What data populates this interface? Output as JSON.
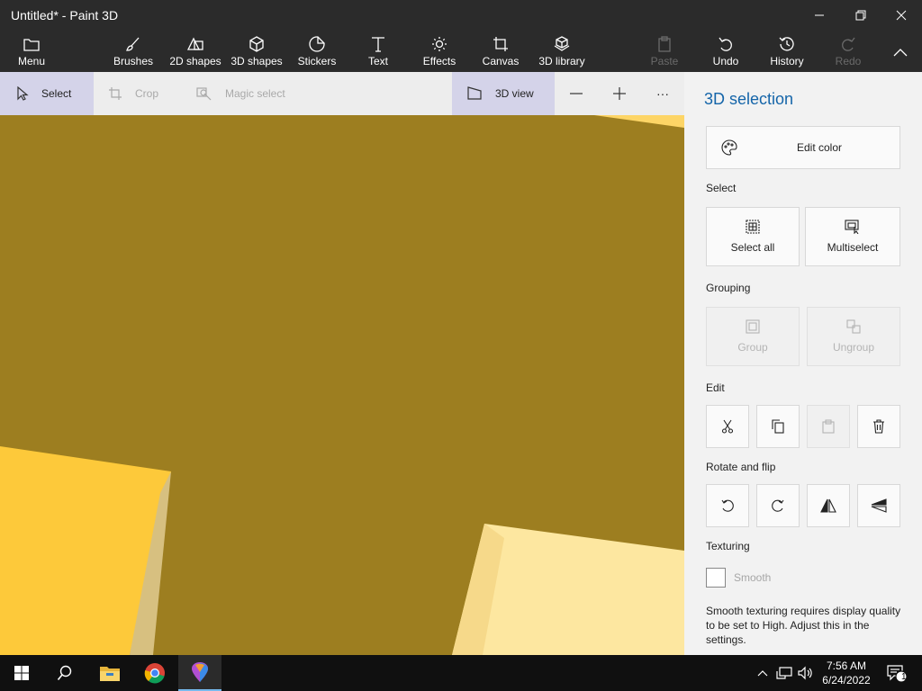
{
  "window": {
    "title": "Untitled* - Paint 3D"
  },
  "ribbon": {
    "menu": "Menu",
    "brushes": "Brushes",
    "shapes2d": "2D shapes",
    "shapes3d": "3D shapes",
    "stickers": "Stickers",
    "text": "Text",
    "effects": "Effects",
    "canvas": "Canvas",
    "library3d": "3D library",
    "paste": "Paste",
    "undo": "Undo",
    "history": "History",
    "redo": "Redo"
  },
  "toolbar": {
    "select": "Select",
    "crop": "Crop",
    "magic_select": "Magic select",
    "view3d": "3D view",
    "more": "···"
  },
  "panel": {
    "title": "3D selection",
    "edit_color": "Edit color",
    "select_heading": "Select",
    "select_all": "Select all",
    "multiselect": "Multiselect",
    "grouping_heading": "Grouping",
    "group": "Group",
    "ungroup": "Ungroup",
    "edit_heading": "Edit",
    "rotate_heading": "Rotate and flip",
    "texturing_heading": "Texturing",
    "smooth_label": "Smooth",
    "smooth_checked": false,
    "note": "Smooth texturing requires display quality to be set to High. Adjust this in the settings."
  },
  "taskbar": {
    "time": "7:56 AM",
    "date": "6/24/2022",
    "notification_count": "1"
  },
  "colors": {
    "canvas_bg": "#9d7e20",
    "accent_title": "#1565a9",
    "shape_yellow": "#fdc93a",
    "shape_light": "#fde7a0"
  }
}
